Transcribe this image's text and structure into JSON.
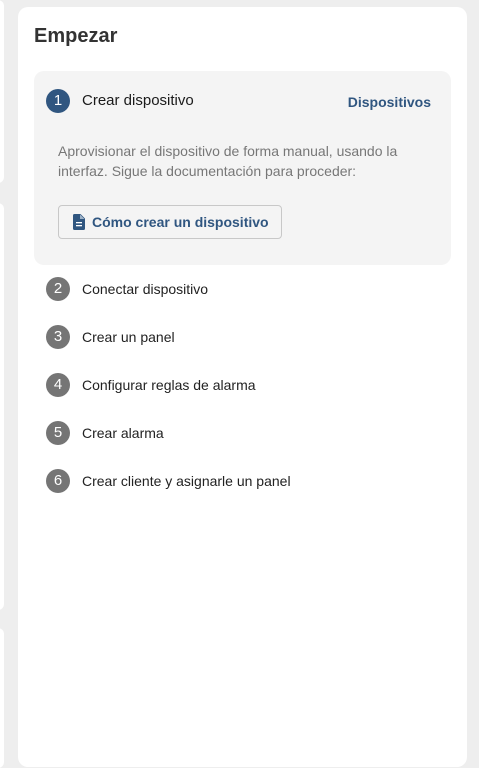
{
  "card": {
    "title": "Empezar"
  },
  "active_step": {
    "number": "1",
    "label": "Crear dispositivo",
    "link_label": "Dispositivos",
    "description": "Aprovisionar el dispositivo de forma manual, usando la interfaz. Sigue la documentación para proceder:",
    "doc_button_label": "Cómo crear un dispositivo",
    "doc_button_icon": "document-icon"
  },
  "steps": [
    {
      "number": "2",
      "label": "Conectar dispositivo"
    },
    {
      "number": "3",
      "label": "Crear un panel"
    },
    {
      "number": "4",
      "label": "Configurar reglas de alarma"
    },
    {
      "number": "5",
      "label": "Crear alarma"
    },
    {
      "number": "6",
      "label": "Crear cliente y asignarle un panel"
    }
  ],
  "colors": {
    "accent": "#305680",
    "inactive_step": "#757575",
    "panel_bg": "#f4f4f4"
  }
}
